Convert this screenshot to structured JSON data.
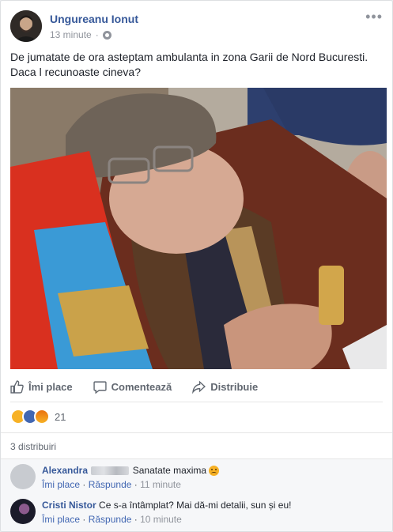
{
  "post": {
    "author": "Ungureanu Ionut",
    "time": "13 minute",
    "separator": "·",
    "text_line1": "De jumatate de ora asteptam ambulanta in zona Garii de Nord Bucuresti.",
    "text_line2": "Daca l recunoaste cineva?"
  },
  "actions": {
    "like": "Îmi place",
    "comment": "Comentează",
    "share": "Distribuie"
  },
  "reactions": {
    "count": "21",
    "types": [
      "sad-icon",
      "like-icon",
      "angry-icon"
    ]
  },
  "shares": {
    "text": "3 distribuiri"
  },
  "comments": [
    {
      "author": "Alexandra",
      "text": "Sanatate maxima",
      "like": "Îmi place",
      "reply": "Răspunde",
      "time": "11 minute"
    },
    {
      "author": "Cristi Nistor",
      "text": "Ce s-a întâmplat? Mai dă-mi detalii, sun și eu!",
      "like": "Îmi place",
      "reply": "Răspunde",
      "time": "10 minute"
    }
  ],
  "colors": {
    "link": "#365899",
    "muted": "#90949c",
    "accent": "#4267b2"
  }
}
